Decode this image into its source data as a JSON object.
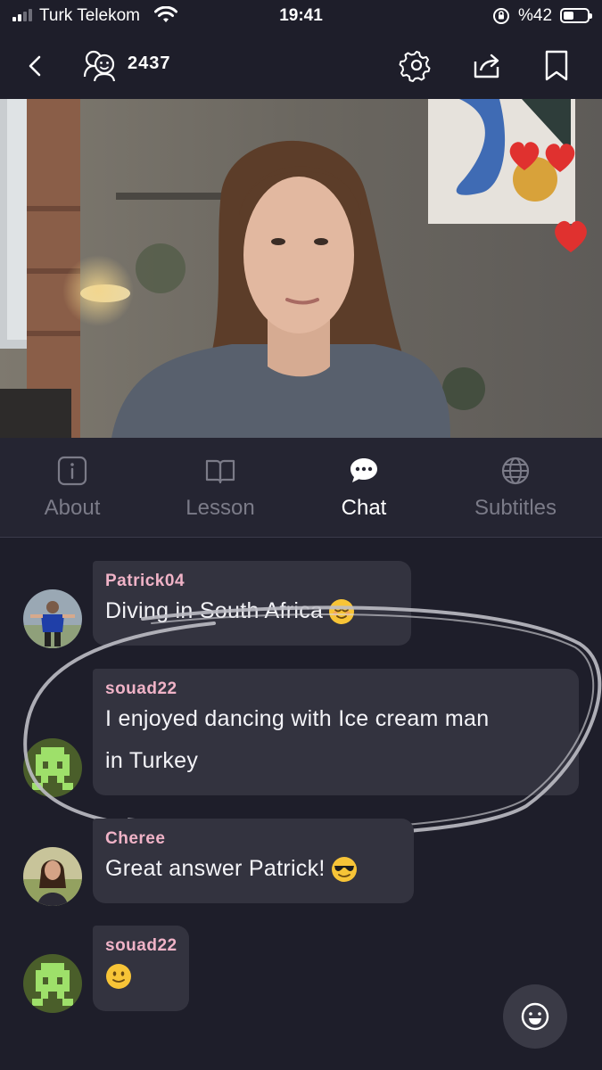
{
  "status": {
    "carrier": "Turk Telekom",
    "time": "19:41",
    "battery_pct": "%42",
    "battery_level": 0.42
  },
  "header": {
    "viewer_count": "2437"
  },
  "tabs": [
    {
      "label": "About",
      "icon": "info-icon",
      "active": false
    },
    {
      "label": "Lesson",
      "icon": "book-icon",
      "active": false
    },
    {
      "label": "Chat",
      "icon": "chat-bubble-icon",
      "active": true
    },
    {
      "label": "Subtitles",
      "icon": "globe-icon",
      "active": false
    }
  ],
  "chat": {
    "messages": [
      {
        "user": "Patrick04",
        "text": "Diving in South Africa",
        "emoji": "relieved-face-emoji"
      },
      {
        "user": "souad22",
        "text_line1": "I enjoyed dancing with Ice cream man",
        "text_line2": "in Turkey"
      },
      {
        "user": "Cheree",
        "text": "Great answer Patrick!",
        "emoji": "sunglasses-face-emoji"
      },
      {
        "user": "souad22",
        "emoji": "slightly-smiling-face-emoji"
      }
    ]
  },
  "colors": {
    "background": "#1e1e2a",
    "tab_bar": "#252532",
    "bubble": "#33333f",
    "username": "#f0b3c7",
    "inactive_tab": "#7b7b88"
  }
}
